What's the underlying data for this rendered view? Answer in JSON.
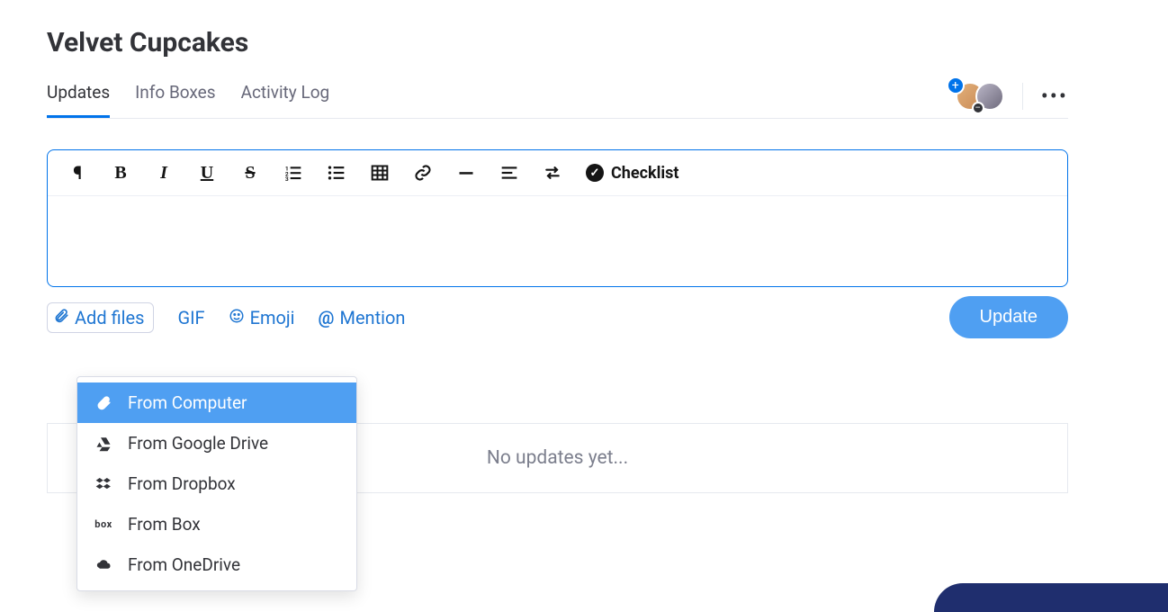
{
  "title": "Velvet Cupcakes",
  "tabs": {
    "updates": "Updates",
    "infoBoxes": "Info Boxes",
    "activityLog": "Activity Log"
  },
  "toolbar": {
    "checklist": "Checklist"
  },
  "actions": {
    "addFiles": "Add files",
    "gif": "GIF",
    "emoji": "Emoji",
    "mention": "Mention",
    "update": "Update"
  },
  "addFilesMenu": {
    "computer": "From Computer",
    "gdrive": "From Google Drive",
    "dropbox": "From Dropbox",
    "box": "From Box",
    "onedrive": "From OneDrive"
  },
  "empty": "No updates yet...",
  "moreDots": "•••"
}
